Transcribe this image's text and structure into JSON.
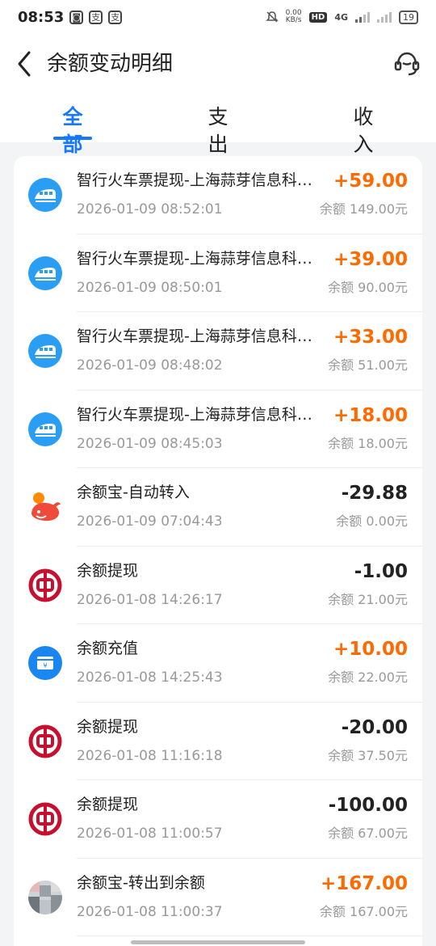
{
  "status_bar": {
    "time": "08:53",
    "net_speed": "0.00",
    "net_unit": "KB/s",
    "hd": "HD",
    "signal_type": "4G",
    "battery": "19"
  },
  "header": {
    "title": "余额变动明细",
    "back_icon": "chevron-left-icon",
    "service_icon": "customer-service-icon"
  },
  "tabs": [
    {
      "label": "全部",
      "active": true
    },
    {
      "label": "支出",
      "active": false
    },
    {
      "label": "收入",
      "active": false
    }
  ],
  "colors": {
    "accent": "#1677ff",
    "income": "#ff6a00",
    "bank_red": "#c8102e"
  },
  "transactions": [
    {
      "name": "智行火车票提现-上海蒜芽信息科…",
      "amount": "+59.00",
      "date": "2026-01-09 08:52:01",
      "balance": "余额 149.00元",
      "icon": "train-icon"
    },
    {
      "name": "智行火车票提现-上海蒜芽信息科…",
      "amount": "+39.00",
      "date": "2026-01-09 08:50:01",
      "balance": "余额 90.00元",
      "icon": "train-icon"
    },
    {
      "name": "智行火车票提现-上海蒜芽信息科…",
      "amount": "+33.00",
      "date": "2026-01-09 08:48:02",
      "balance": "余额 51.00元",
      "icon": "train-icon"
    },
    {
      "name": "智行火车票提现-上海蒜芽信息科…",
      "amount": "+18.00",
      "date": "2026-01-09 08:45:03",
      "balance": "余额 18.00元",
      "icon": "train-icon"
    },
    {
      "name": "余额宝-自动转入",
      "amount": "-29.88",
      "date": "2026-01-09 07:04:43",
      "balance": "余额 0.00元",
      "icon": "yuebao-icon"
    },
    {
      "name": "余额提现",
      "amount": "-1.00",
      "date": "2026-01-08 14:26:17",
      "balance": "余额 21.00元",
      "icon": "bank-of-china-icon"
    },
    {
      "name": "余额充值",
      "amount": "+10.00",
      "date": "2026-01-08 14:25:43",
      "balance": "余额 22.00元",
      "icon": "recharge-icon"
    },
    {
      "name": "余额提现",
      "amount": "-20.00",
      "date": "2026-01-08 11:16:18",
      "balance": "余额 37.50元",
      "icon": "bank-of-china-icon"
    },
    {
      "name": "余额提现",
      "amount": "-100.00",
      "date": "2026-01-08 11:00:57",
      "balance": "余额 67.00元",
      "icon": "bank-of-china-icon"
    },
    {
      "name": "余额宝-转出到余额",
      "amount": "+167.00",
      "date": "2026-01-08 11:00:37",
      "balance": "余额 167.00元",
      "icon": "avatar-icon"
    }
  ]
}
